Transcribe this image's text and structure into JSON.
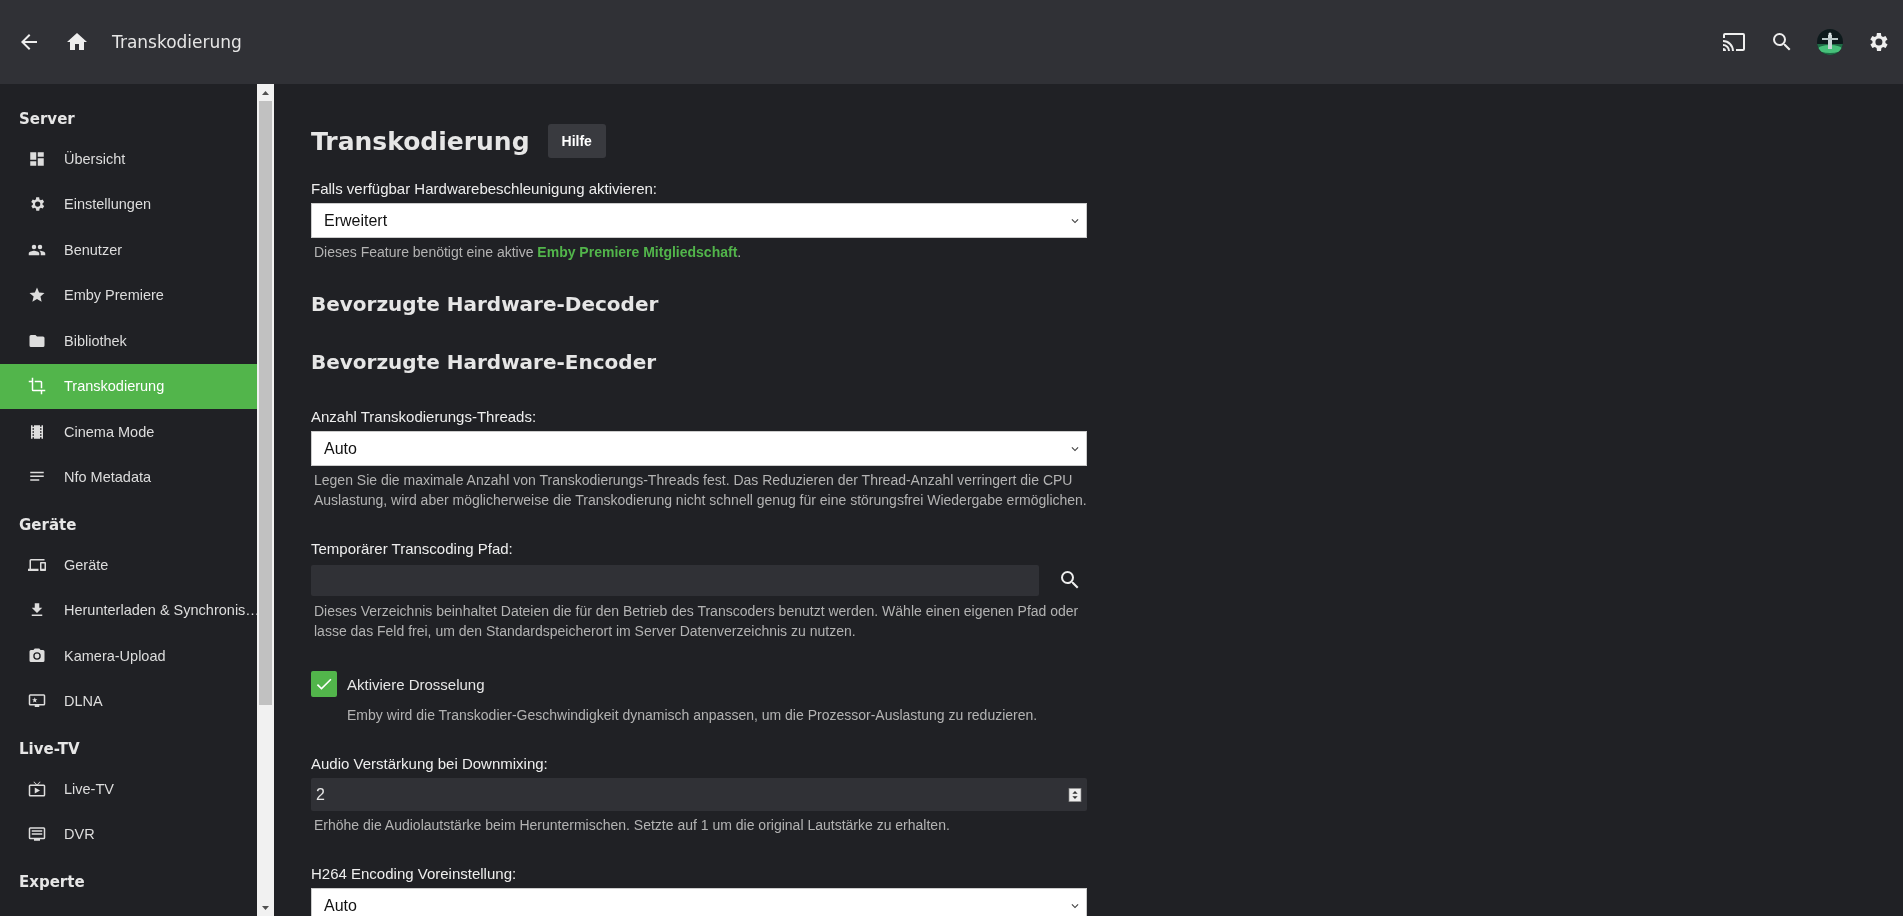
{
  "header": {
    "title": "Transkodierung"
  },
  "sidebar": {
    "sections": [
      {
        "title": "Server",
        "items": [
          {
            "label": "Übersicht",
            "selected": false
          },
          {
            "label": "Einstellungen",
            "selected": false
          },
          {
            "label": "Benutzer",
            "selected": false
          },
          {
            "label": "Emby Premiere",
            "selected": false
          },
          {
            "label": "Bibliothek",
            "selected": false
          },
          {
            "label": "Transkodierung",
            "selected": true
          },
          {
            "label": "Cinema Mode",
            "selected": false
          },
          {
            "label": "Nfo Metadata",
            "selected": false
          }
        ]
      },
      {
        "title": "Geräte",
        "items": [
          {
            "label": "Geräte",
            "selected": false
          },
          {
            "label": "Herunterladen & Synchronis…",
            "selected": false
          },
          {
            "label": "Kamera-Upload",
            "selected": false
          },
          {
            "label": "DLNA",
            "selected": false
          }
        ]
      },
      {
        "title": "Live-TV",
        "items": [
          {
            "label": "Live-TV",
            "selected": false
          },
          {
            "label": "DVR",
            "selected": false
          }
        ]
      },
      {
        "title": "Experte"
      }
    ]
  },
  "main": {
    "title": "Transkodierung",
    "help_button": "Hilfe",
    "fields": [
      {
        "kind": "select",
        "label": "Falls verfügbar Hardwarebeschleunigung aktivieren:",
        "value": "Erweitert",
        "help": "Dieses Feature benötigt eine aktive **Emby Premiere Mitgliedschaft**."
      },
      {
        "kind": "heading",
        "text": "Bevorzugte Hardware-Decoder"
      },
      {
        "kind": "heading",
        "text": "Bevorzugte Hardware-Encoder"
      },
      {
        "kind": "select",
        "label": "Anzahl Transkodierungs-Threads:",
        "value": "Auto",
        "help": "Legen Sie die maximale Anzahl von Transkodierungs-Threads fest. Das Reduzieren der Thread-Anzahl verringert die CPU Auslastung, wird aber möglicherweise die Transkodierung nicht schnell genug für eine störungsfrei Wiedergabe ermöglichen."
      },
      {
        "kind": "path",
        "label": "Temporärer Transcoding Pfad:",
        "help": "Dieses Verzeichnis beinhaltet Dateien die für den Betrieb des Transcoders benutzt werden. Wähle einen eigenen Pfad oder lasse das Feld frei, um den Standardspeicherort im Server Datenverzeichnis zu nutzen."
      },
      {
        "kind": "checkbox",
        "label": "Aktiviere Drosselung",
        "checked": true,
        "help": "Emby wird die Transkodier-Geschwindigkeit dynamisch anpassen, um die Prozessor-Auslastung zu reduzieren."
      },
      {
        "kind": "number",
        "label": "Audio Verstärkung bei Downmixing:",
        "value": "2",
        "help": "Erhöhe die Audiolautstärke beim Heruntermischen. Setzte auf 1 um die original Lautstärke zu erhalten."
      },
      {
        "kind": "select",
        "label": "H264 Encoding Voreinstellung:",
        "value": "Auto"
      }
    ]
  }
}
